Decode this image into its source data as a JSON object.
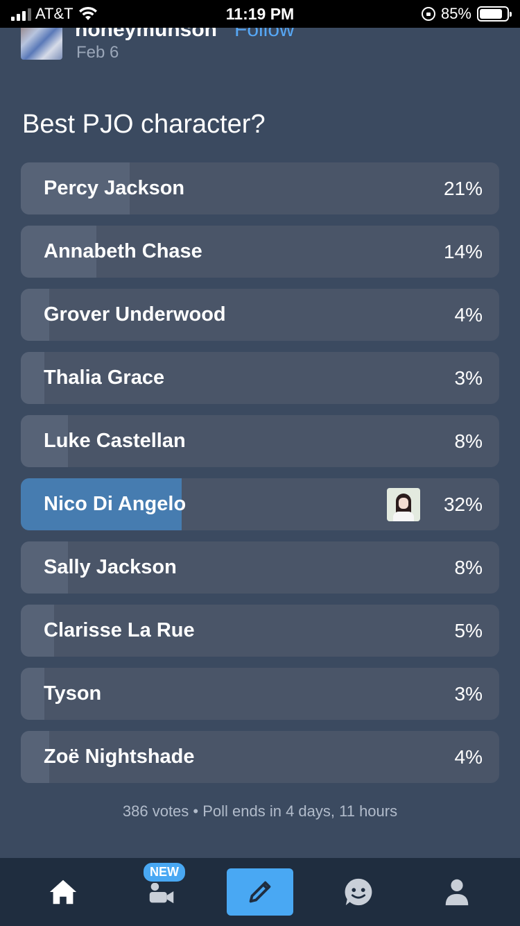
{
  "status_bar": {
    "carrier": "AT&T",
    "time": "11:19 PM",
    "battery": "85%",
    "battery_level": 0.85
  },
  "post": {
    "username": "honeymunson",
    "follow_label": "Follow",
    "date": "Feb 6"
  },
  "poll": {
    "question": "Best PJO character?",
    "options": [
      {
        "label": "Percy Jackson",
        "percent_text": "21%",
        "percent": 21
      },
      {
        "label": "Annabeth Chase",
        "percent_text": "14%",
        "percent": 14
      },
      {
        "label": "Grover Underwood",
        "percent_text": "4%",
        "percent": 4
      },
      {
        "label": "Thalia Grace",
        "percent_text": "3%",
        "percent": 3
      },
      {
        "label": "Luke Castellan",
        "percent_text": "8%",
        "percent": 8
      },
      {
        "label": "Nico Di Angelo",
        "percent_text": "32%",
        "percent": 32,
        "selected": true
      },
      {
        "label": "Sally Jackson",
        "percent_text": "8%",
        "percent": 8
      },
      {
        "label": "Clarisse La Rue",
        "percent_text": "5%",
        "percent": 5
      },
      {
        "label": "Tyson",
        "percent_text": "3%",
        "percent": 3
      },
      {
        "label": "Zoë Nightshade",
        "percent_text": "4%",
        "percent": 4
      }
    ],
    "footer": "386 votes • Poll ends in 4 days, 11 hours"
  },
  "tab_bar": {
    "new_badge": "NEW",
    "tabs": [
      {
        "icon": "home-icon"
      },
      {
        "icon": "video-chat-icon"
      },
      {
        "icon": "pencil-icon"
      },
      {
        "icon": "chat-icon"
      },
      {
        "icon": "profile-icon"
      }
    ]
  },
  "colors": {
    "background": "#3b4a60",
    "option_bg": "#4a5568",
    "option_fill": "#576377",
    "selected_fill": "#467cb0",
    "accent": "#49a8f3",
    "follow": "#56a7f5"
  }
}
